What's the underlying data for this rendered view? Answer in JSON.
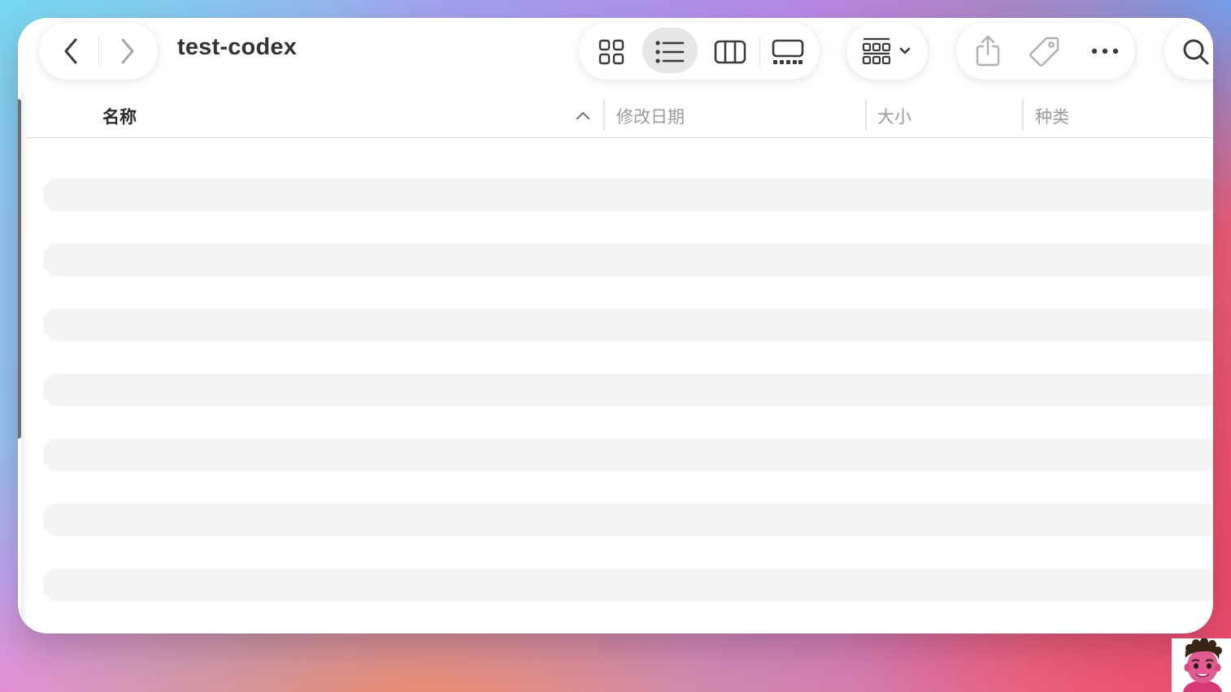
{
  "window": {
    "title": "test-codex"
  },
  "toolbar": {
    "back_icon": "chevron-left-icon",
    "forward_icon": "chevron-right-icon",
    "view_modes": [
      {
        "name": "icon-view",
        "icon": "grid-icon",
        "selected": false
      },
      {
        "name": "list-view",
        "icon": "list-icon",
        "selected": true
      },
      {
        "name": "column-view",
        "icon": "columns-icon",
        "selected": false
      },
      {
        "name": "gallery-view",
        "icon": "gallery-icon",
        "selected": false
      }
    ],
    "group_icon": "group-by-icon",
    "actions": [
      "share-icon",
      "tag-icon",
      "more-icon"
    ],
    "search_icon": "search-icon"
  },
  "columns": {
    "name": "名称",
    "modified": "修改日期",
    "size": "大小",
    "kind": "种类",
    "sort_indicator": "chevron-up-icon"
  },
  "rows_placeholder_count": 7,
  "colors": {
    "selected_view_bg": "#e6e6e8",
    "stripe": "#f3f4f4",
    "title_text": "#333336"
  }
}
